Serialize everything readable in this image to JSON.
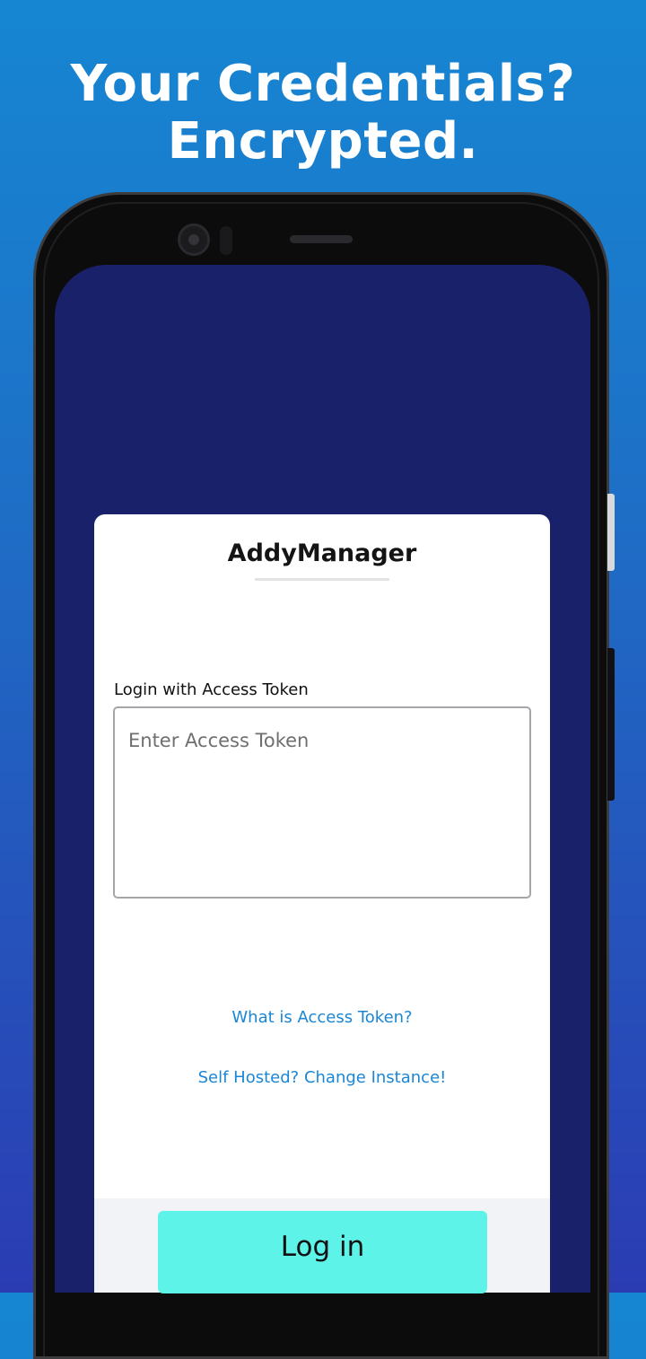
{
  "promo": {
    "headline_line1": "Your Credentials?",
    "headline_line2": "Encrypted."
  },
  "login_card": {
    "app_title": "AddyManager",
    "field_label": "Login with Access Token",
    "token_placeholder": "Enter Access Token",
    "token_value": "",
    "what_is_link": "What is Access Token?",
    "self_hosted_link": "Self Hosted? Change Instance!",
    "login_button": "Log in"
  },
  "colors": {
    "screen_background": "#1a216b",
    "link": "#1b86d4",
    "login_button": "#5ef3e9"
  }
}
